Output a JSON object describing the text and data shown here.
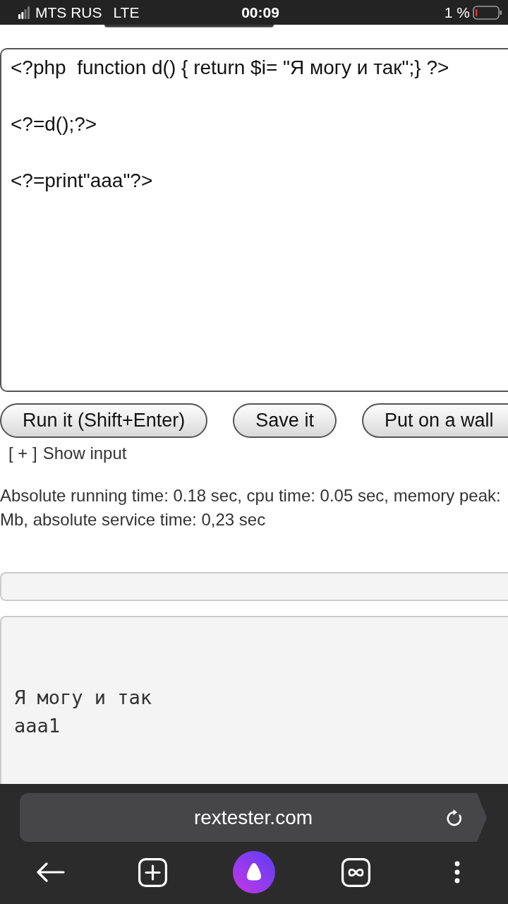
{
  "status_bar": {
    "carrier": "MTS RUS",
    "network": "LTE",
    "time": "00:09",
    "battery": "1 %"
  },
  "editor": {
    "lines": [
      "<?php  function d() { return $i= \"Я могу и так\";} ?>",
      "<?=d();?>",
      "<?=print\"aaa\"?>"
    ]
  },
  "buttons": [
    {
      "label": "Run it (Shift+Enter)"
    },
    {
      "label": "Save it"
    },
    {
      "label": "Put on a wall"
    }
  ],
  "input_toggle": {
    "toggle": "[ + ]",
    "label": "Show input"
  },
  "stats": {
    "lines": [
      "Absolute running time: 0.18 sec, cpu time: 0.05 sec, memory peak:",
      "Mb, absolute service time: 0,23 sec"
    ]
  },
  "output": {
    "lines": [
      "Я могу и так",
      "aaa1"
    ]
  },
  "browser": {
    "url": "rextester.com"
  }
}
